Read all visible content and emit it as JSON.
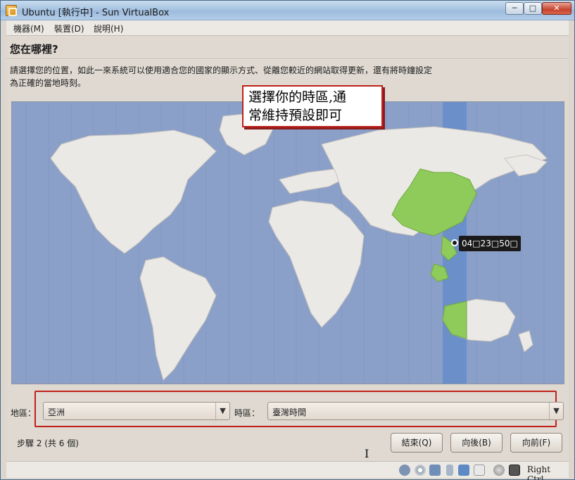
{
  "window": {
    "title": "Ubuntu [執行中] - Sun VirtualBox",
    "minimize": "─",
    "maximize": "□",
    "close": "✕"
  },
  "menu": {
    "items": [
      "機器(M)",
      "裝置(D)",
      "說明(H)"
    ]
  },
  "page": {
    "heading": "您在哪裡?",
    "description": "請選擇您的位置，如此一來系統可以使用適合您的國家的顯示方式、從離您較近的網站取得更新，還有將時鐘設定為正確的當地時刻。"
  },
  "callout": {
    "line1": "選擇你的時區,通",
    "line2": "常維持預設即可"
  },
  "map": {
    "time_label": "04□23□50□",
    "colors": {
      "ocean": "#8ba0c8",
      "land": "#ebe9e6",
      "selected": "#8fcb5a",
      "timezone_band": "#6b8fc9"
    }
  },
  "region": {
    "label": "地區：",
    "value": "亞洲"
  },
  "timezone": {
    "label": "時區：",
    "value": "臺灣時間"
  },
  "footer": {
    "steps": "步驟 2 (共 6 個)"
  },
  "buttons": {
    "quit": "結束(Q)",
    "back": "向後(B)",
    "forward": "向前(F)"
  },
  "status": {
    "host_key": "Right Ctrl",
    "icons": [
      "harddisk-icon",
      "cdrom-icon",
      "network-icon",
      "usb-icon",
      "shared-folder-icon",
      "display-icon",
      "mouse-capture-icon",
      "host-key-icon"
    ]
  }
}
